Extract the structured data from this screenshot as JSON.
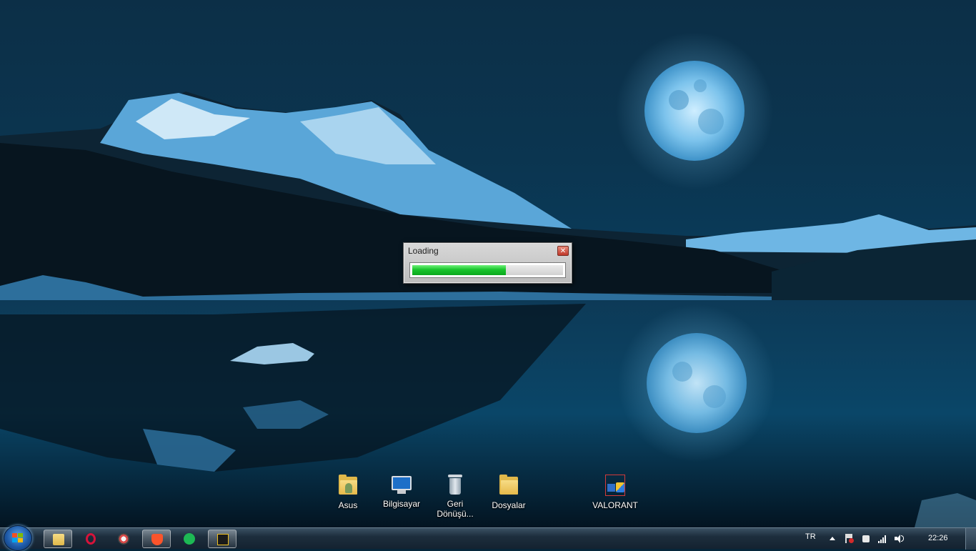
{
  "dialog": {
    "title": "Loading",
    "close_glyph": "✕",
    "progress_fraction": 0.62
  },
  "desktop_icons": [
    {
      "label": "Asus",
      "icon": "user-folder-icon"
    },
    {
      "label": "Bilgisayar",
      "icon": "computer-icon"
    },
    {
      "label": "Geri Dönüşü...",
      "icon": "recycle-bin-icon"
    },
    {
      "label": "Dosyalar",
      "icon": "folder-icon"
    },
    {
      "label": "VALORANT",
      "icon": "valorant-shortcut-icon"
    }
  ],
  "taskbar": {
    "pinned": [
      {
        "name": "file-explorer",
        "icon": "folder-icon"
      },
      {
        "name": "opera",
        "icon": "opera-icon"
      },
      {
        "name": "app",
        "icon": "app-icon"
      },
      {
        "name": "brave",
        "icon": "brave-icon"
      },
      {
        "name": "spotify",
        "icon": "spotify-icon"
      },
      {
        "name": "loader",
        "icon": "z-app-icon",
        "active": true
      }
    ]
  },
  "tray": {
    "language": "TR",
    "clock": "22:26"
  },
  "colors": {
    "progress_green": "#19c42c",
    "taskbar": "#1d2e3d",
    "sky": "#0b3550"
  }
}
